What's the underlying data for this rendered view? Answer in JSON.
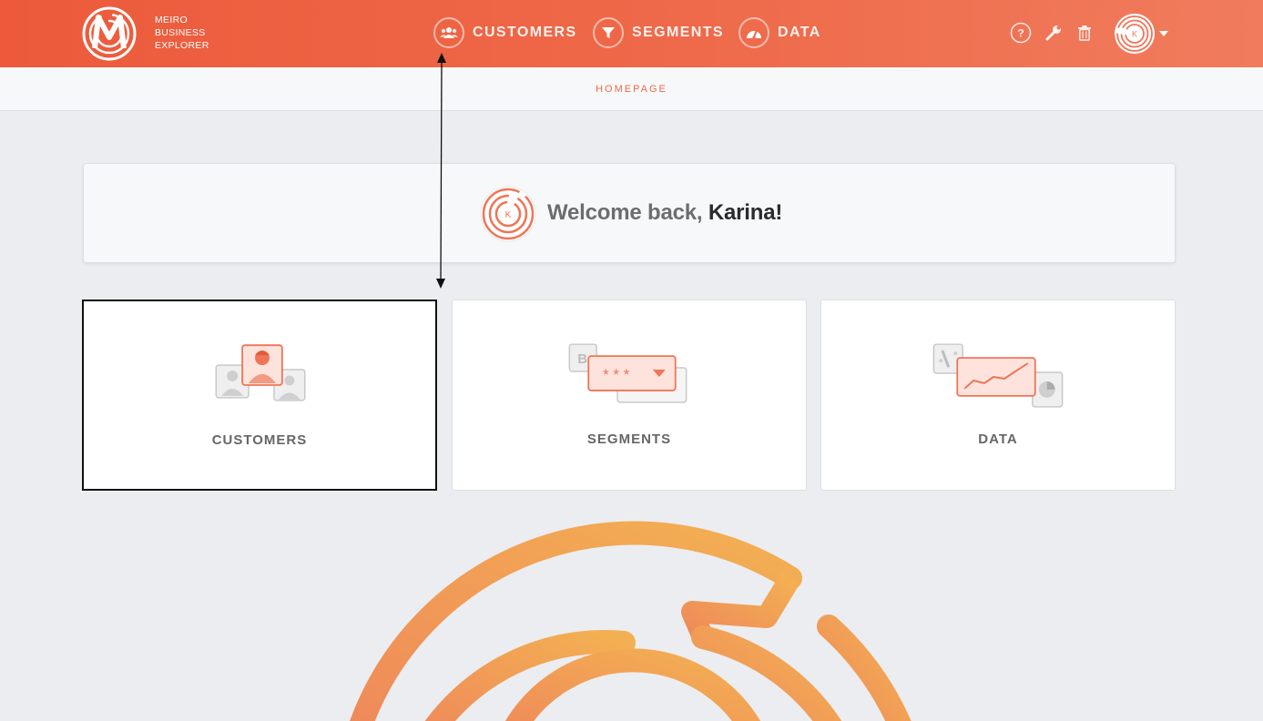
{
  "brand": {
    "line1": "MEIRO",
    "line2": "BUSINESS",
    "line3": "EXPLORER",
    "logo_icon": "meiro-logo-icon"
  },
  "nav": [
    {
      "label": "CUSTOMERS",
      "icon": "customers-icon"
    },
    {
      "label": "SEGMENTS",
      "icon": "funnel-icon"
    },
    {
      "label": "DATA",
      "icon": "dashboard-gauge-icon"
    }
  ],
  "toolbar": {
    "help_icon": "help-icon",
    "settings_icon": "wrench-icon",
    "trash_icon": "trash-icon"
  },
  "user": {
    "initial": "K",
    "name": "Karina"
  },
  "breadcrumb": "HOMEPAGE",
  "welcome": {
    "prefix": "Welcome back, ",
    "name": "Karina",
    "suffix": "!"
  },
  "cards": [
    {
      "label": "CUSTOMERS",
      "selected": true
    },
    {
      "label": "SEGMENTS",
      "selected": false
    },
    {
      "label": "DATA",
      "selected": false
    }
  ],
  "segments_card": {
    "mask": "* * *",
    "letter": "B"
  },
  "colors": {
    "brand_orange": "#ec5a3b",
    "accent": "#ec6a4a",
    "logo_yellow": "#f3b052"
  }
}
